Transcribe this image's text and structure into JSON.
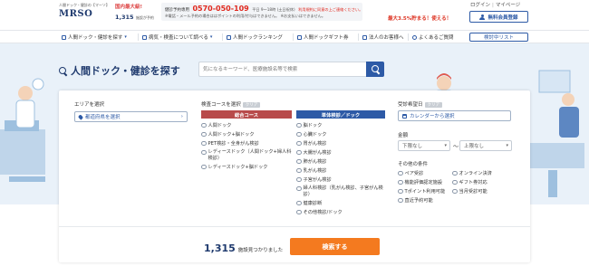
{
  "header": {
    "logo_tagline": "人間ドック・健診の【マーソ】",
    "logo": "MRSO",
    "domestic_badge": "国内最大級!",
    "facility_count": "1,315",
    "facility_count_suffix": "施設が予約",
    "phone_label": "健診予約専用",
    "phone_number": "0570-050-109",
    "phone_hours": "平日 9～18時 (土日祝休)",
    "phone_notice": "利用規約に同意の上ご連絡ください。",
    "phone_note": "※電話・メール予約の場合ははポイントの利用/付与はできません。 ※お支払いはできません。",
    "promo_text": "最大3.5%貯まる！使える！",
    "login_label": "ログイン",
    "mypage_label": "マイページ",
    "register_label": "無料会員登録"
  },
  "nav": {
    "items": [
      {
        "label": "人間ドック・健診を探す"
      },
      {
        "label": "病気・検査について調べる"
      },
      {
        "label": "人間ドックランキング"
      },
      {
        "label": "人間ドックギフト券"
      },
      {
        "label": "法人のお客様へ"
      },
      {
        "label": "よくあるご質問"
      }
    ],
    "favorites_label": "検討中リスト"
  },
  "hero": {
    "title": "人間ドック・健診を探す",
    "search_placeholder": "気になるキーワード、医療施設名等で検索"
  },
  "filters": {
    "area": {
      "label": "エリアを選択",
      "select_label": "都道府県を選択"
    },
    "course": {
      "label": "検査コースを選択",
      "clear_label": "クリア",
      "general_header": "総合コース",
      "general": [
        "人間ドック",
        "人間ドック+脳ドック",
        "PET検診・全身がん検診",
        "レディースドック（人間ドック+婦人科検診）",
        "レディースドック+脳ドック"
      ],
      "single_header": "単体検診／ドック",
      "single": [
        "脳ドック",
        "心臓ドック",
        "胃がん検診",
        "大腸がん検診",
        "肺がん検診",
        "乳がん検診",
        "子宮がん検診",
        "婦人科検診（乳がん検診、子宮がん検診）",
        "健康診断",
        "その他検診/ドック"
      ]
    },
    "date": {
      "label": "受診希望日",
      "clear_label": "クリア",
      "select_label": "カレンダーから選択"
    },
    "price": {
      "label": "金額",
      "min_label": "下限なし",
      "tilde": "～",
      "max_label": "上限なし"
    },
    "other": {
      "label": "その他の条件",
      "options": [
        "ペア受診",
        "オンライン決済",
        "機能評価認定施設",
        "ギフト券対応",
        "Tポイント利用可能",
        "当月受診可能",
        "直近予約可能"
      ]
    }
  },
  "result": {
    "count": "1,315",
    "count_suffix": "施設見つかりました",
    "submit_label": "検索する"
  },
  "colors": {
    "navy": "#1f3a6e",
    "blue": "#2d5aa6",
    "course_header_red": "#b84b4b",
    "orange": "#f47a1f",
    "hero_bg": "#e9f1f9"
  }
}
